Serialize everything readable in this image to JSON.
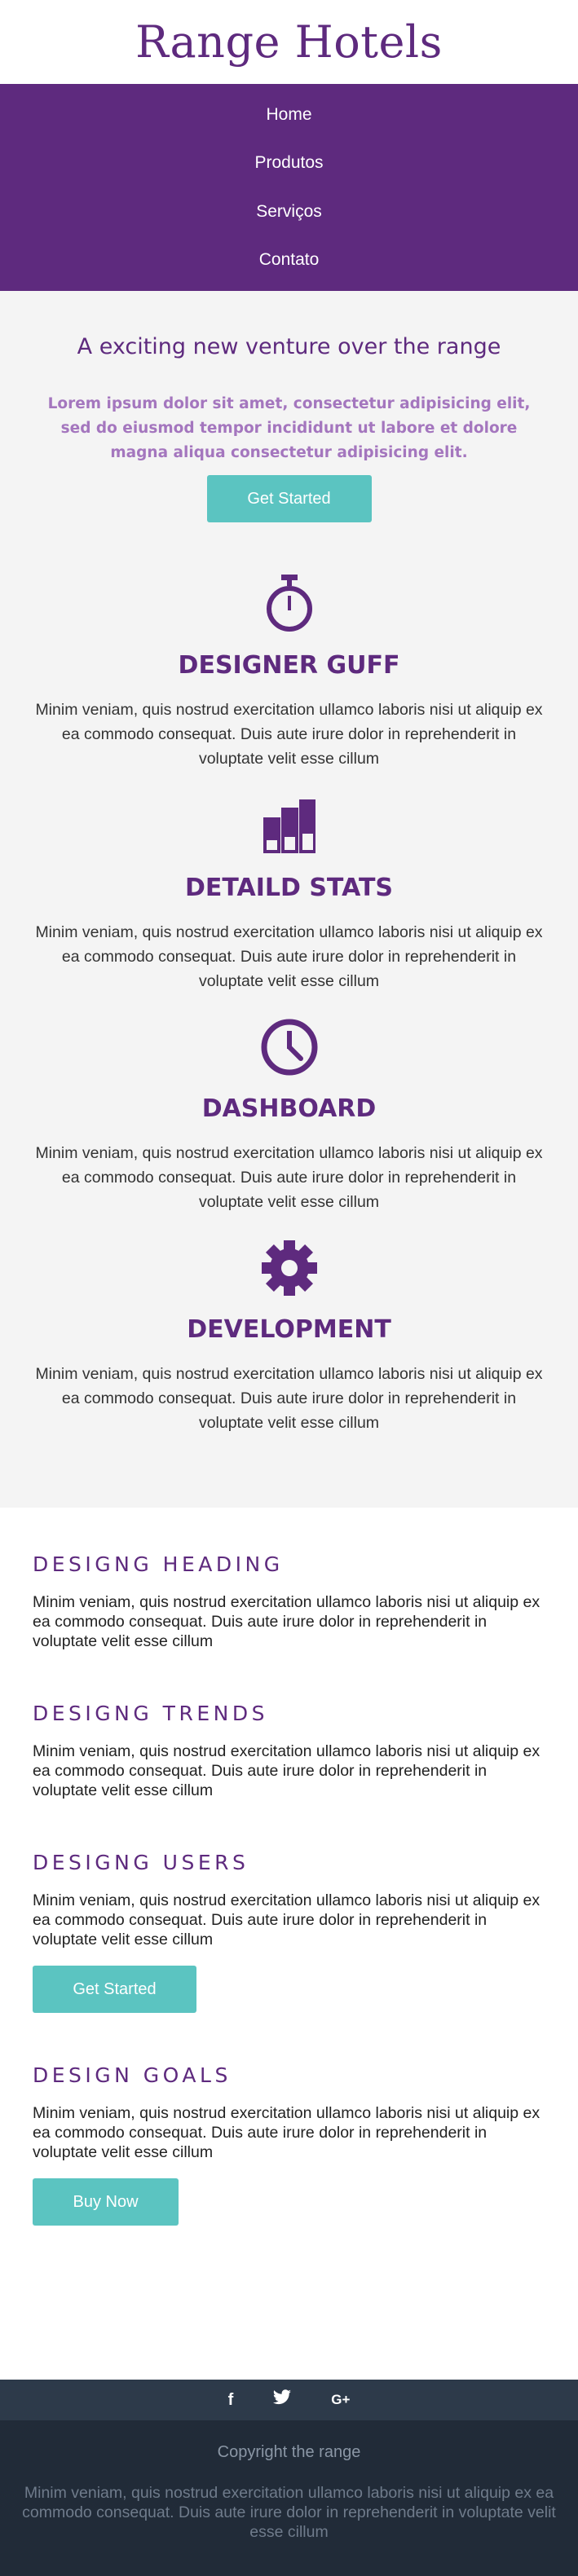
{
  "brand": {
    "logo": "Range Hotels"
  },
  "nav": [
    "Home",
    "Produtos",
    "Serviços",
    "Contato"
  ],
  "hero": {
    "title": "A exciting new venture over the range",
    "lead": "Lorem ipsum dolor sit amet, consectetur adipisicing elit, sed do eiusmod tempor incididunt ut labore et dolore magna aliqua consectetur adipisicing elit.",
    "button": "Get Started"
  },
  "features": [
    {
      "icon": "stopwatch-icon",
      "title": "DESIGNER GUFF",
      "text": "Minim veniam, quis nostrud exercitation ullamco laboris nisi ut aliquip ex ea commodo consequat. Duis aute irure dolor in reprehenderit in voluptate velit esse cillum"
    },
    {
      "icon": "bar-stats-icon",
      "title": "DETAILD STATS",
      "text": "Minim veniam, quis nostrud exercitation ullamco laboris nisi ut aliquip ex ea commodo consequat. Duis aute irure dolor in reprehenderit in voluptate velit esse cillum"
    },
    {
      "icon": "clock-icon",
      "title": "DASHBOARD",
      "text": "Minim veniam, quis nostrud exercitation ullamco laboris nisi ut aliquip ex ea commodo consequat. Duis aute irure dolor in reprehenderit in voluptate velit esse cillum"
    },
    {
      "icon": "gear-icon",
      "title": "DEVELOPMENT",
      "text": "Minim veniam, quis nostrud exercitation ullamco laboris nisi ut aliquip ex ea commodo consequat. Duis aute irure dolor in reprehenderit in voluptate velit esse cillum"
    }
  ],
  "sections": [
    {
      "title": "DESIGNG HEADING",
      "text": "Minim veniam, quis nostrud exercitation ullamco laboris nisi ut aliquip ex ea commodo consequat. Duis aute irure dolor in reprehenderit in voluptate velit esse cillum"
    },
    {
      "title": "DESIGNG TRENDS",
      "text": "Minim veniam, quis nostrud exercitation ullamco laboris nisi ut aliquip ex ea commodo consequat. Duis aute irure dolor in reprehenderit in voluptate velit esse cillum"
    },
    {
      "title": "DESIGNG USERS",
      "text": "Minim veniam, quis nostrud exercitation ullamco laboris nisi ut aliquip ex ea commodo consequat. Duis aute irure dolor in reprehenderit in voluptate velit esse cillum",
      "button": "Get Started"
    },
    {
      "title": "DESIGN GOALS",
      "text": "Minim veniam, quis nostrud exercitation ullamco laboris nisi ut aliquip ex ea commodo consequat. Duis aute irure dolor in reprehenderit in voluptate velit esse cillum",
      "button": "Buy Now"
    }
  ],
  "social": [
    "facebook-icon",
    "twitter-icon",
    "google-plus-icon"
  ],
  "social_glyphs": {
    "facebook": "f",
    "googleplus": "G+"
  },
  "footer": {
    "copyright": "Copyright the range",
    "text": "Minim veniam, quis nostrud exercitation ullamco laboris nisi ut aliquip ex ea commodo consequat. Duis aute irure dolor in reprehenderit in voluptate velit esse cillum"
  },
  "colors": {
    "brand_purple": "#5e2a7e",
    "accent_teal": "#5bc4c1",
    "footer_dark": "#212b38"
  }
}
